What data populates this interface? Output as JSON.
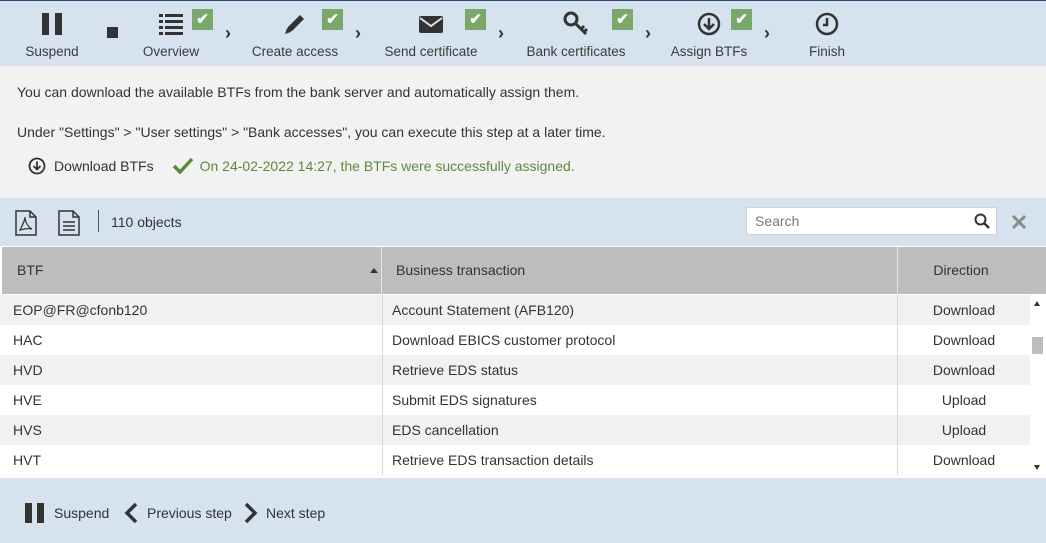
{
  "wizard": {
    "suspend_label": "Suspend",
    "steps": [
      {
        "label": "Overview",
        "icon": "list-icon",
        "done": true
      },
      {
        "label": "Create access",
        "icon": "pencil-icon",
        "done": true
      },
      {
        "label": "Send certificate",
        "icon": "envelope-icon",
        "done": true
      },
      {
        "label": "Bank certificates",
        "icon": "key-icon",
        "done": true
      },
      {
        "label": "Assign BTFs",
        "icon": "download-circle-icon",
        "done": true
      },
      {
        "label": "Finish",
        "icon": "clock-icon",
        "done": false
      }
    ],
    "check_mark": "✔",
    "chevron": "›"
  },
  "info": {
    "line1": "You can download the available BTFs from the bank server and automatically assign them.",
    "line2": "Under \"Settings\" > \"User settings\" > \"Bank accesses\", you can execute this step at a later time.",
    "download_label": "Download BTFs",
    "success_message": "On 24-02-2022 14:27, the BTFs were successfully assigned."
  },
  "toolbar": {
    "count": "110 objects",
    "search_placeholder": "Search"
  },
  "table": {
    "columns": [
      "BTF",
      "Business transaction",
      "Direction"
    ],
    "sorted_column": "BTF",
    "sort_direction": "ascending",
    "rows": [
      {
        "btf": "EOP@FR@cfonb120",
        "transaction": "Account Statement (AFB120)",
        "direction": "Download"
      },
      {
        "btf": "HAC",
        "transaction": "Download EBICS customer protocol",
        "direction": "Download"
      },
      {
        "btf": "HVD",
        "transaction": "Retrieve EDS status",
        "direction": "Download"
      },
      {
        "btf": "HVE",
        "transaction": "Submit EDS signatures",
        "direction": "Upload"
      },
      {
        "btf": "HVS",
        "transaction": "EDS cancellation",
        "direction": "Upload"
      },
      {
        "btf": "HVT",
        "transaction": "Retrieve EDS transaction details",
        "direction": "Download"
      }
    ]
  },
  "footer": {
    "suspend_label": "Suspend",
    "previous_label": "Previous step",
    "next_label": "Next step"
  },
  "colors": {
    "header_bg": "#d6e3ef",
    "check_green": "#7aa86a",
    "success_green": "#5c8a3a",
    "table_header_bg": "#bdbdbd"
  }
}
